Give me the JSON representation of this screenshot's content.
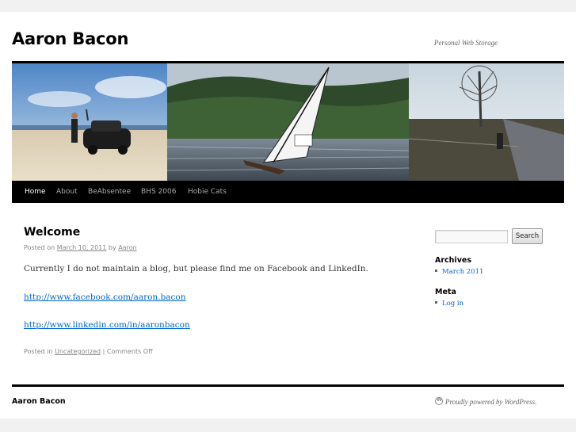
{
  "header": {
    "site_title": "Aaron Bacon",
    "description": "Personal Web Storage"
  },
  "nav": {
    "items": [
      {
        "label": "Home",
        "current": true
      },
      {
        "label": "About"
      },
      {
        "label": "BeAbsentee"
      },
      {
        "label": "BHS 2006"
      },
      {
        "label": "Hobie Cats"
      }
    ]
  },
  "post": {
    "title": "Welcome",
    "posted_on_label": "Posted on",
    "date": "March 10, 2011",
    "by_label": "by",
    "author": "Aaron",
    "paragraph": "Currently I do not maintain a blog, but please find me on Facebook and LinkedIn.",
    "links": [
      "http://www.facebook.com/aaron.bacon",
      "http://www.linkedin.com/in/aaronbacon"
    ],
    "posted_in_label": "Posted in",
    "category": "Uncategorized",
    "separator": "|",
    "comments": "Comments Off"
  },
  "sidebar": {
    "search_button": "Search",
    "archives_title": "Archives",
    "archives_items": [
      "March 2011"
    ],
    "meta_title": "Meta",
    "meta_items": [
      "Log in"
    ]
  },
  "footer": {
    "site_title": "Aaron Bacon",
    "powered_by": "Proudly powered by WordPress."
  },
  "colors": {
    "link": "#0066cc",
    "nav_bg": "#000000",
    "page_bg": "#f1f1f1"
  }
}
